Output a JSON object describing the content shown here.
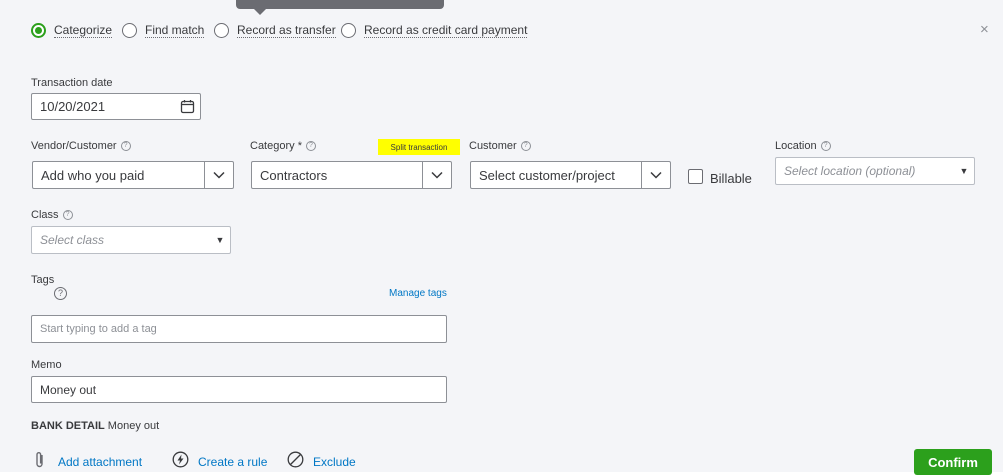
{
  "match_options": [
    {
      "label": "Categorize",
      "selected": true
    },
    {
      "label": "Find match",
      "selected": false
    },
    {
      "label": "Record as transfer",
      "selected": false
    },
    {
      "label": "Record as credit card payment",
      "selected": false
    }
  ],
  "close_icon": "×",
  "transaction_date": {
    "label": "Transaction date",
    "value": "10/20/2021"
  },
  "vendor": {
    "label": "Vendor/Customer",
    "placeholder": "Add who you paid"
  },
  "category": {
    "label": "Category *",
    "value": "Contractors",
    "split_link": "Split transaction"
  },
  "customer": {
    "label": "Customer",
    "placeholder": "Select customer/project"
  },
  "billable": {
    "label": "Billable",
    "checked": false
  },
  "location": {
    "label": "Location",
    "placeholder": "Select location (optional)"
  },
  "class_field": {
    "label": "Class",
    "placeholder": "Select class"
  },
  "tags": {
    "label": "Tags",
    "manage_link": "Manage tags",
    "placeholder": "Start typing to add a tag"
  },
  "memo": {
    "label": "Memo",
    "value": "Money out"
  },
  "bank_detail": {
    "label": "BANK DETAIL",
    "value": "Money out"
  },
  "footer": {
    "add_attachment": "Add attachment",
    "create_rule": "Create a rule",
    "exclude": "Exclude",
    "confirm": "Confirm"
  },
  "help_glyph": "?",
  "colors": {
    "accent": "#2ca01c",
    "link": "#0077c5",
    "highlight": "#ffff00"
  }
}
